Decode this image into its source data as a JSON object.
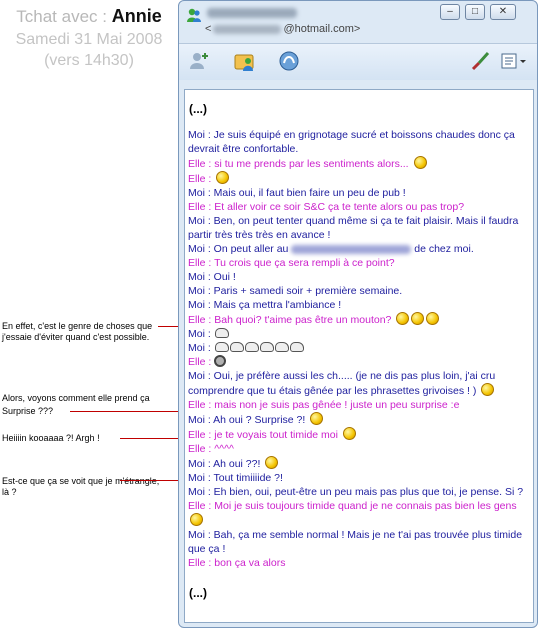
{
  "header": {
    "prefix": "Tchat avec :",
    "name": "Annie",
    "date": "Samedi 31 Mai 2008",
    "time": "(vers 14h30)"
  },
  "annotations": [
    "En effet, c'est le genre de choses que j'essaie d'éviter quand c'est possible.",
    "Alors, voyons comment elle prend ça",
    "Surprise ???",
    "Heiiiin kooaaaa ?! Argh !",
    "Est-ce que ça se voit que je m'étrangle, là ?"
  ],
  "window": {
    "email_prefix": "<",
    "email_suffix": "@hotmail.com>",
    "controls": [
      "minimize",
      "maximize",
      "close"
    ],
    "toolbar_icons": [
      "add-contact-icon",
      "share-files-icon",
      "voice-call-icon",
      "paint-brush-icon",
      "window-options-icon"
    ]
  },
  "conversation": {
    "top_ellipsis": "(...)",
    "bottom_ellipsis": "(...)",
    "messages": [
      {
        "text": "Moi : Je suis équipé en grignotage sucré et boissons chaudes donc ça devrait être confortable."
      },
      {
        "text": "Elle : si tu me prends par les sentiments alors..."
      },
      {
        "text": "Elle :"
      },
      {
        "text": "Moi : Mais oui, il faut bien faire un peu de pub !"
      },
      {
        "text": "Elle : Et aller voir ce soir S&C ça te tente alors ou pas trop?"
      },
      {
        "text": "Moi : Ben, on peut tenter quand même si ça te fait plaisir. Mais il faudra partir très très très en avance !"
      },
      {
        "a": "Moi : On peut aller au",
        "b": "de chez moi."
      },
      {
        "text": "Elle : Tu crois que ça sera rempli à ce point?"
      },
      {
        "text": "Moi : Oui !"
      },
      {
        "text": "Moi : Paris + samedi soir + première semaine."
      },
      {
        "text": "Moi : Mais ça mettra l'ambiance !"
      },
      {
        "text": "Elle : Bah quoi? t'aime pas être un mouton?"
      },
      {
        "text": "Moi :"
      },
      {
        "text": "Moi :"
      },
      {
        "text": "Elle :"
      },
      {
        "text": "Moi : Oui, je préfère aussi les ch..... (je ne dis pas plus loin, j'ai cru comprendre que tu étais gênée par les phrasettes grivoises ! )"
      },
      {
        "text": "Elle : mais non je suis pas gênée ! juste un peu surprise :e"
      },
      {
        "text": "Moi : Ah oui ? Surprise ?!"
      },
      {
        "text": "Elle : je te voyais tout timide moi"
      },
      {
        "text": "Elle : ^^^^"
      },
      {
        "text": "Moi : Ah oui ??!"
      },
      {
        "text": "Moi : Tout timiiiide ?!"
      },
      {
        "text": "Moi : Eh bien, oui, peut-être un peu mais pas plus que toi, je pense. Si ?"
      },
      {
        "text": "Elle : Moi je suis toujours timide quand je ne connais pas bien les gens"
      },
      {
        "text": "Moi : Bah, ça me semble normal ! Mais je ne t'ai pas trouvée plus timide que ça !"
      },
      {
        "text": "Elle : bon ça va alors"
      }
    ]
  },
  "colors": {
    "moi": "#1e1e9e",
    "elle": "#cc22cc",
    "pointer": "#c00000",
    "window_bg": "#dde9f5"
  }
}
